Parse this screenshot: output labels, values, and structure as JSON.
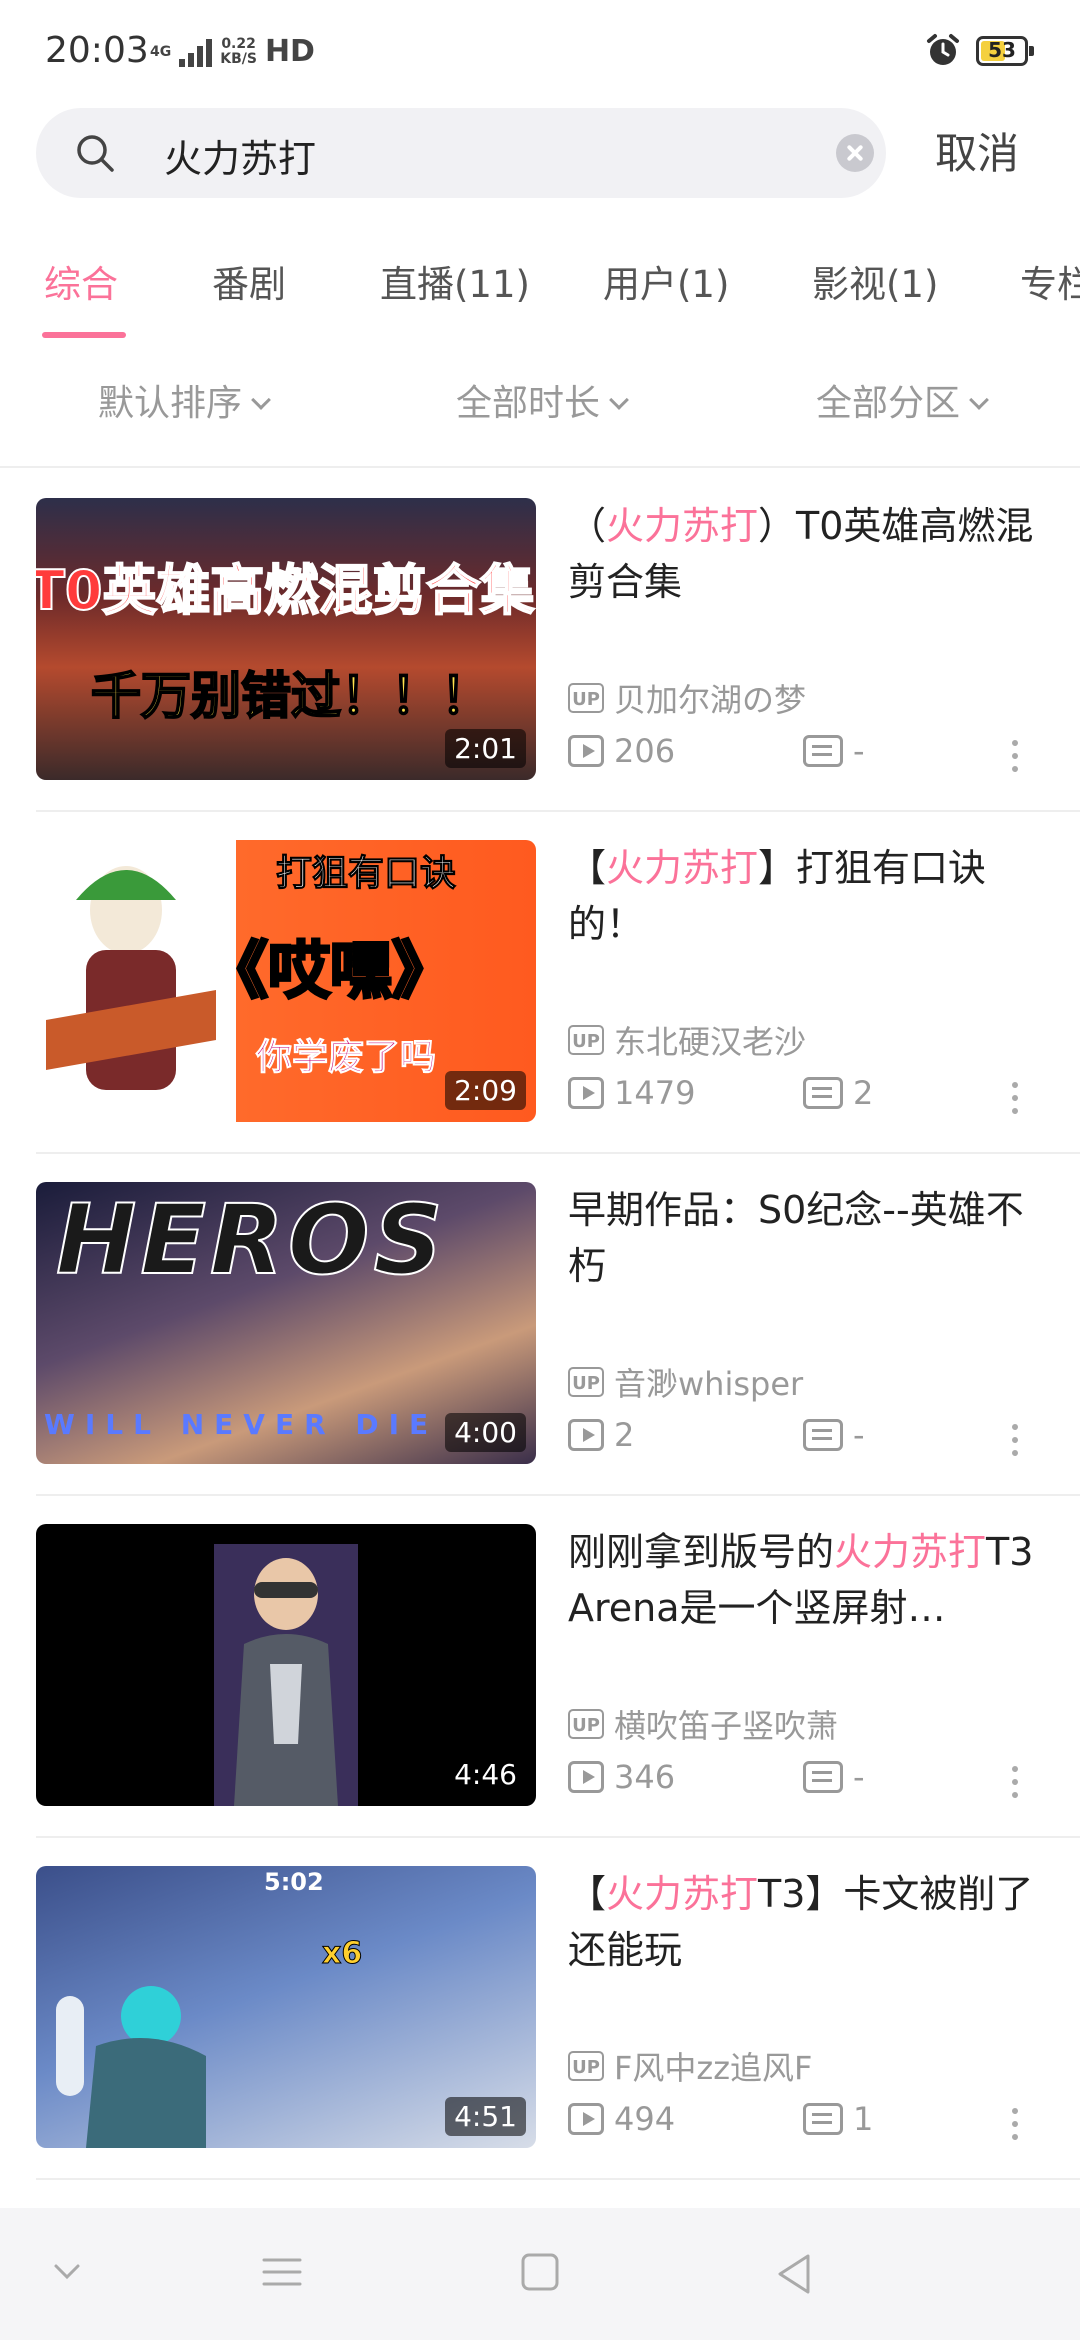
{
  "status_bar": {
    "time": "20:03",
    "network": "4G",
    "speed_top": "0.22",
    "speed_bottom": "KB/S",
    "hd": "HD",
    "battery": "53"
  },
  "search": {
    "query": "火力苏打",
    "cancel_label": "取消"
  },
  "tabs": [
    {
      "label": "综合",
      "active": true
    },
    {
      "label": "番剧",
      "active": false
    },
    {
      "label": "直播(11)",
      "active": false
    },
    {
      "label": "用户(1)",
      "active": false
    },
    {
      "label": "影视(1)",
      "active": false
    },
    {
      "label": "专栏",
      "active": false
    }
  ],
  "filters": {
    "sort": "默认排序",
    "duration": "全部时长",
    "zone": "全部分区"
  },
  "videos": [
    {
      "title_pre": "（",
      "title_hl": "火力苏打",
      "title_post": "）T0英雄高燃混剪合集",
      "uploader": "贝加尔湖の梦",
      "views": "206",
      "danmaku": "-",
      "duration": "2:01",
      "thumb_text_1": "T0英雄高燃混剪合集",
      "thumb_text_2": "千万别错过！！！"
    },
    {
      "title_pre": "【",
      "title_hl": "火力苏打",
      "title_post": "】打狙有口诀的！",
      "uploader": "东北硬汉老沙",
      "views": "1479",
      "danmaku": "2",
      "duration": "2:09",
      "thumb_text_1": "打狙有口诀",
      "thumb_text_2": "《哎嘿》",
      "thumb_text_3": "你学废了吗"
    },
    {
      "title_pre": "早期作品：S0纪念--英雄不朽",
      "title_hl": "",
      "title_post": "",
      "uploader": "音渺whisper",
      "views": "2",
      "danmaku": "-",
      "duration": "4:00",
      "thumb_text_1": "HEROS",
      "thumb_text_2": "WILL NEVER DIE"
    },
    {
      "title_pre": "刚刚拿到版号的",
      "title_hl": "火力苏打",
      "title_post": "T3 Arena是一个竖屏射…",
      "uploader": "横吹笛子竖吹萧",
      "views": "346",
      "danmaku": "-",
      "duration": "4:46"
    },
    {
      "title_pre": "【",
      "title_hl": "火力苏打",
      "title_post": "T3】卡文被削了还能玩",
      "uploader": "F风中zz追风F",
      "views": "494",
      "danmaku": "1",
      "duration": "4:51",
      "thumb_text_1": "5:02",
      "thumb_text_2": "x6"
    }
  ],
  "up_badge": "UP",
  "colors": {
    "accent": "#fb7299",
    "muted": "#999999",
    "text": "#222222"
  },
  "icons": {
    "search": "search-icon",
    "clear": "clear-icon",
    "play": "play-count-icon",
    "danmaku": "danmaku-icon",
    "more": "more-vertical-icon"
  }
}
